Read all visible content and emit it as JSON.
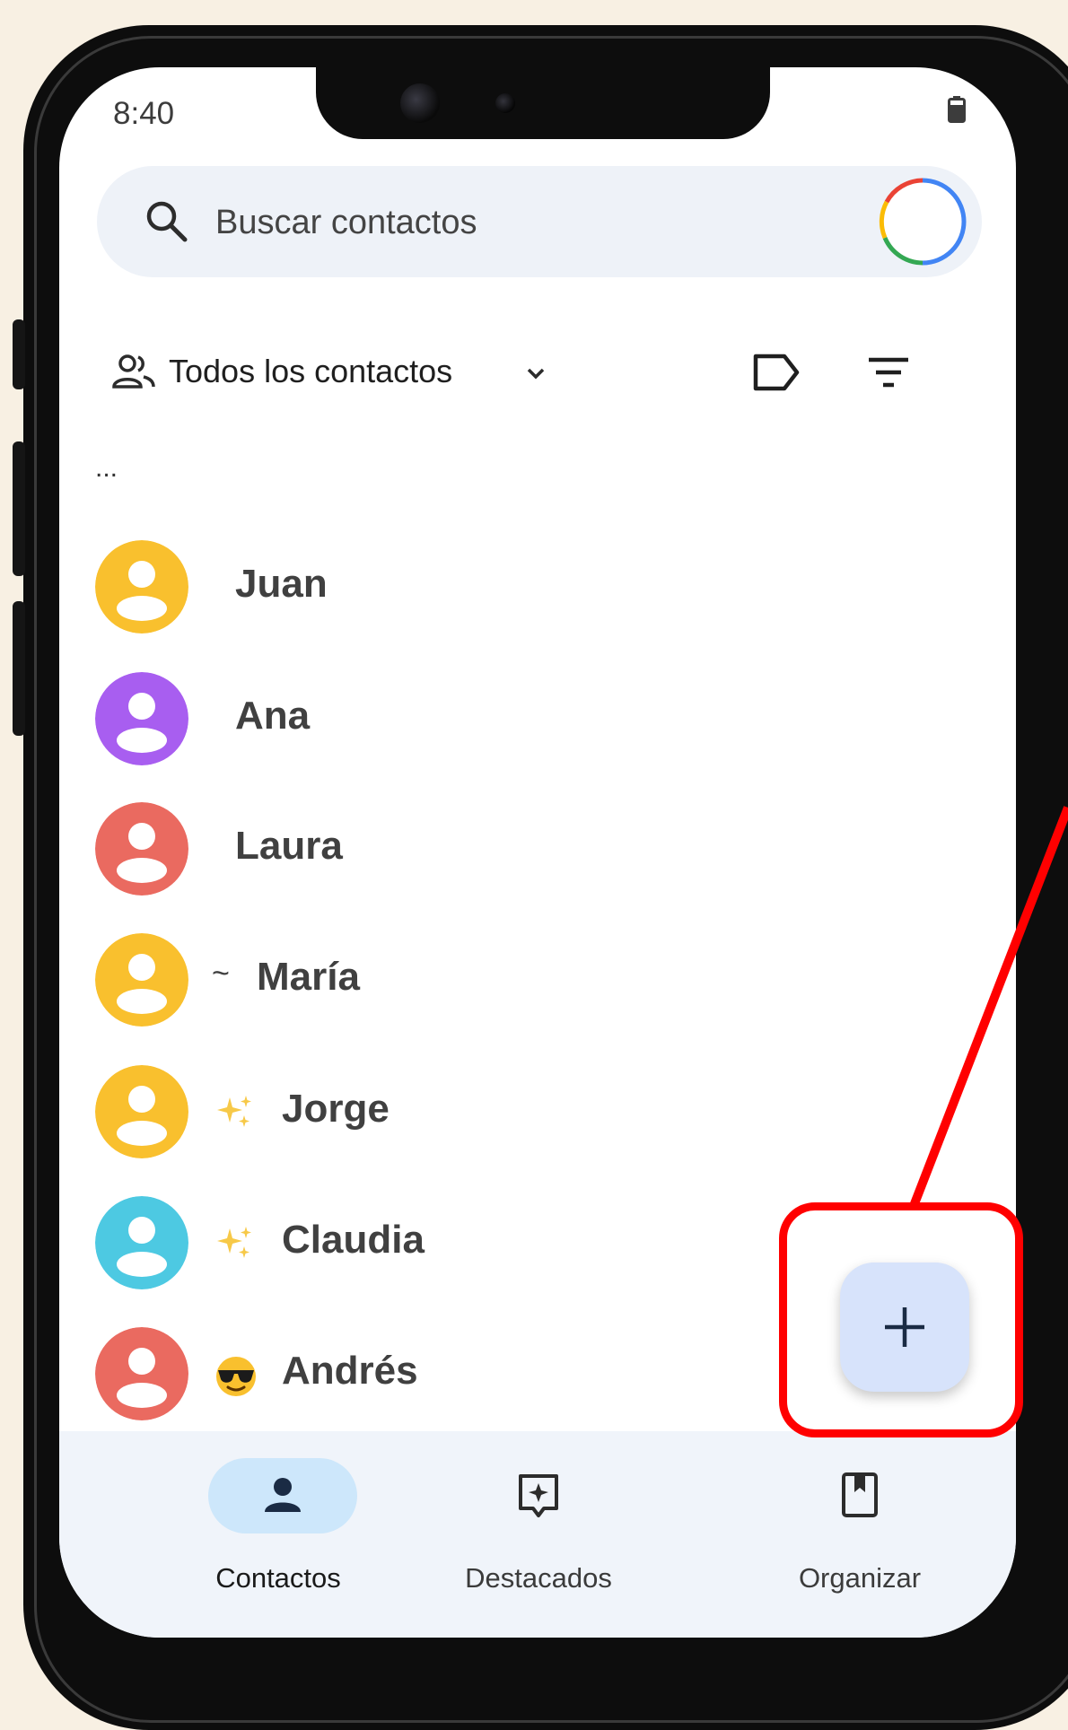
{
  "status_bar": {
    "time": "8:40"
  },
  "search": {
    "placeholder": "Buscar contactos"
  },
  "filter": {
    "label": "Todos los contactos"
  },
  "list": {
    "ellipsis": "...",
    "contacts": [
      {
        "name": "Juan",
        "prefix": "",
        "color": "#f9c02e"
      },
      {
        "name": "Ana",
        "prefix": "",
        "color": "#a85ef0"
      },
      {
        "name": "Laura",
        "prefix": "",
        "color": "#ea6a60"
      },
      {
        "name": "María",
        "prefix": "~",
        "color": "#f9c02e"
      },
      {
        "name": "Jorge",
        "prefix": "sparkles-emoji",
        "color": "#f9c02e"
      },
      {
        "name": "Claudia",
        "prefix": "sparkles-emoji",
        "color": "#4dc9e2"
      },
      {
        "name": "Andrés",
        "prefix": "sunglasses-emoji",
        "color": "#ea6a60"
      }
    ]
  },
  "fab": {
    "icon": "plus-icon"
  },
  "bottom_nav": {
    "items": [
      {
        "label": "Contactos",
        "icon": "person-icon",
        "active": true
      },
      {
        "label": "Destacados",
        "icon": "star-card-icon",
        "active": false
      },
      {
        "label": "Organizar",
        "icon": "bookmark-icon",
        "active": false
      }
    ]
  },
  "colors": {
    "highlight": "#ff0000",
    "fab_bg": "#d7e3fb",
    "nav_active_pill": "#cde7fb",
    "search_bg": "#eef2f8"
  }
}
